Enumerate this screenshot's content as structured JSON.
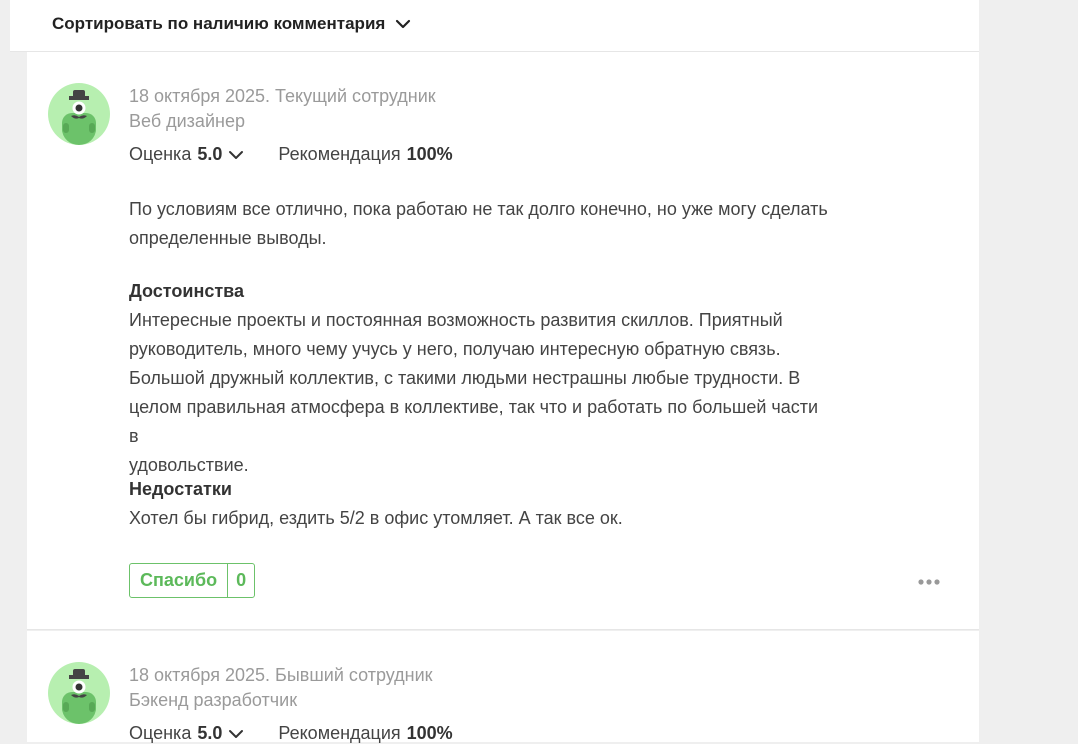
{
  "sort": {
    "label": "Сортировать по наличию комментария"
  },
  "reviews": [
    {
      "date_status": "18 октября 2025. Текущий сотрудник",
      "role": "Веб дизайнер",
      "rating_label": "Оценка",
      "rating_value": "5.0",
      "rec_label": "Рекомендация",
      "rec_value": "100%",
      "lines": [
        "По условиям все отлично, пока работаю не так долго конечно, но уже могу сделать",
        "определенные выводы."
      ],
      "pros_title": "Достоинства",
      "pros_lines": [
        "Интересные проекты и постоянная возможность развития скиллов. Приятный",
        "руководитель, много чему учусь у него, получаю интересную обратную связь.",
        "Большой дружный коллектив, с такими людьми нестрашны любые трудности. В",
        "целом правильная атмосфера в коллективе, так что и работать по большей части в",
        "удовольствие."
      ],
      "cons_title": "Недостатки",
      "cons_lines": [
        "Хотел бы гибрид, ездить 5/2 в офис утомляет. А так все ок."
      ],
      "thanks_label": "Спасибо",
      "thanks_count": "0"
    },
    {
      "date_status": "18 октября 2025. Бывший сотрудник",
      "role": "Бэкенд разработчик",
      "rating_label": "Оценка",
      "rating_value": "5.0",
      "rec_label": "Рекомендация",
      "rec_value": "100%"
    }
  ],
  "colors": {
    "accent": "#5cb95a",
    "avatar_bg": "#b7efb0",
    "muted": "#9a9a9a"
  },
  "icons": {
    "sort": "chevron-down-icon",
    "rating": "chevron-down-icon",
    "more": "more-dots-icon",
    "avatar": "monster-avatar-icon"
  }
}
